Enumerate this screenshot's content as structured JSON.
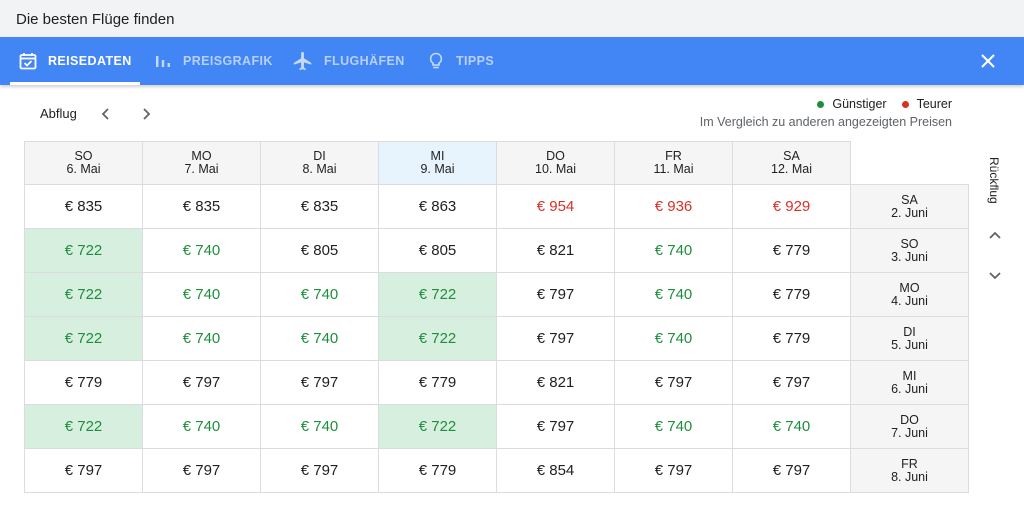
{
  "window": {
    "title": "Die besten Flüge finden"
  },
  "tabs": [
    {
      "label": "REISEDATEN",
      "icon": "calendar-check-icon",
      "active": true
    },
    {
      "label": "PREISGRAFIK",
      "icon": "bar-chart-icon",
      "active": false
    },
    {
      "label": "FLUGHÄFEN",
      "icon": "airplane-icon",
      "active": false
    },
    {
      "label": "TIPPS",
      "icon": "lightbulb-icon",
      "active": false
    }
  ],
  "departure": {
    "label": "Abflug"
  },
  "legend": {
    "cheaper": "Günstiger",
    "pricier": "Teurer",
    "subtitle": "Im Vergleich zu anderen angezeigten Preisen",
    "cheaper_color": "#1e8e3e",
    "pricier_color": "#d93025"
  },
  "return_label": "Rückflug",
  "colors": {
    "header_bar": "#4285f4",
    "highlight": "#d7efdf",
    "selected_column": "#e8f4fd"
  },
  "columns": [
    {
      "day": "SO",
      "date": "6. Mai"
    },
    {
      "day": "MO",
      "date": "7. Mai"
    },
    {
      "day": "DI",
      "date": "8. Mai"
    },
    {
      "day": "MI",
      "date": "9. Mai",
      "selected": true
    },
    {
      "day": "DO",
      "date": "10. Mai"
    },
    {
      "day": "FR",
      "date": "11. Mai"
    },
    {
      "day": "SA",
      "date": "12. Mai"
    }
  ],
  "rows": [
    {
      "day": "SA",
      "date": "2. Juni",
      "cells": [
        {
          "price": "€ 835",
          "status": "normal"
        },
        {
          "price": "€ 835",
          "status": "normal"
        },
        {
          "price": "€ 835",
          "status": "normal"
        },
        {
          "price": "€ 863",
          "status": "normal"
        },
        {
          "price": "€ 954",
          "status": "pricey"
        },
        {
          "price": "€ 936",
          "status": "pricey"
        },
        {
          "price": "€ 929",
          "status": "pricey"
        }
      ]
    },
    {
      "day": "SO",
      "date": "3. Juni",
      "cells": [
        {
          "price": "€ 722",
          "status": "cheap",
          "highlight": true
        },
        {
          "price": "€ 740",
          "status": "cheap"
        },
        {
          "price": "€ 805",
          "status": "normal"
        },
        {
          "price": "€ 805",
          "status": "normal"
        },
        {
          "price": "€ 821",
          "status": "normal"
        },
        {
          "price": "€ 740",
          "status": "cheap"
        },
        {
          "price": "€ 779",
          "status": "normal"
        }
      ]
    },
    {
      "day": "MO",
      "date": "4. Juni",
      "cells": [
        {
          "price": "€ 722",
          "status": "cheap",
          "highlight": true
        },
        {
          "price": "€ 740",
          "status": "cheap"
        },
        {
          "price": "€ 740",
          "status": "cheap"
        },
        {
          "price": "€ 722",
          "status": "cheap",
          "highlight": true
        },
        {
          "price": "€ 797",
          "status": "normal"
        },
        {
          "price": "€ 740",
          "status": "cheap"
        },
        {
          "price": "€ 779",
          "status": "normal"
        }
      ]
    },
    {
      "day": "DI",
      "date": "5. Juni",
      "cells": [
        {
          "price": "€ 722",
          "status": "cheap",
          "highlight": true
        },
        {
          "price": "€ 740",
          "status": "cheap"
        },
        {
          "price": "€ 740",
          "status": "cheap"
        },
        {
          "price": "€ 722",
          "status": "cheap",
          "highlight": true
        },
        {
          "price": "€ 797",
          "status": "normal"
        },
        {
          "price": "€ 740",
          "status": "cheap"
        },
        {
          "price": "€ 779",
          "status": "normal"
        }
      ]
    },
    {
      "day": "MI",
      "date": "6. Juni",
      "cells": [
        {
          "price": "€ 779",
          "status": "normal"
        },
        {
          "price": "€ 797",
          "status": "normal"
        },
        {
          "price": "€ 797",
          "status": "normal"
        },
        {
          "price": "€ 779",
          "status": "normal"
        },
        {
          "price": "€ 821",
          "status": "normal"
        },
        {
          "price": "€ 797",
          "status": "normal"
        },
        {
          "price": "€ 797",
          "status": "normal"
        }
      ]
    },
    {
      "day": "DO",
      "date": "7. Juni",
      "cells": [
        {
          "price": "€ 722",
          "status": "cheap",
          "highlight": true
        },
        {
          "price": "€ 740",
          "status": "cheap"
        },
        {
          "price": "€ 740",
          "status": "cheap"
        },
        {
          "price": "€ 722",
          "status": "cheap",
          "highlight": true
        },
        {
          "price": "€ 797",
          "status": "normal"
        },
        {
          "price": "€ 740",
          "status": "cheap"
        },
        {
          "price": "€ 740",
          "status": "cheap"
        }
      ]
    },
    {
      "day": "FR",
      "date": "8. Juni",
      "cells": [
        {
          "price": "€ 797",
          "status": "normal"
        },
        {
          "price": "€ 797",
          "status": "normal"
        },
        {
          "price": "€ 797",
          "status": "normal"
        },
        {
          "price": "€ 779",
          "status": "normal"
        },
        {
          "price": "€ 854",
          "status": "normal"
        },
        {
          "price": "€ 797",
          "status": "normal"
        },
        {
          "price": "€ 797",
          "status": "normal"
        }
      ]
    }
  ]
}
